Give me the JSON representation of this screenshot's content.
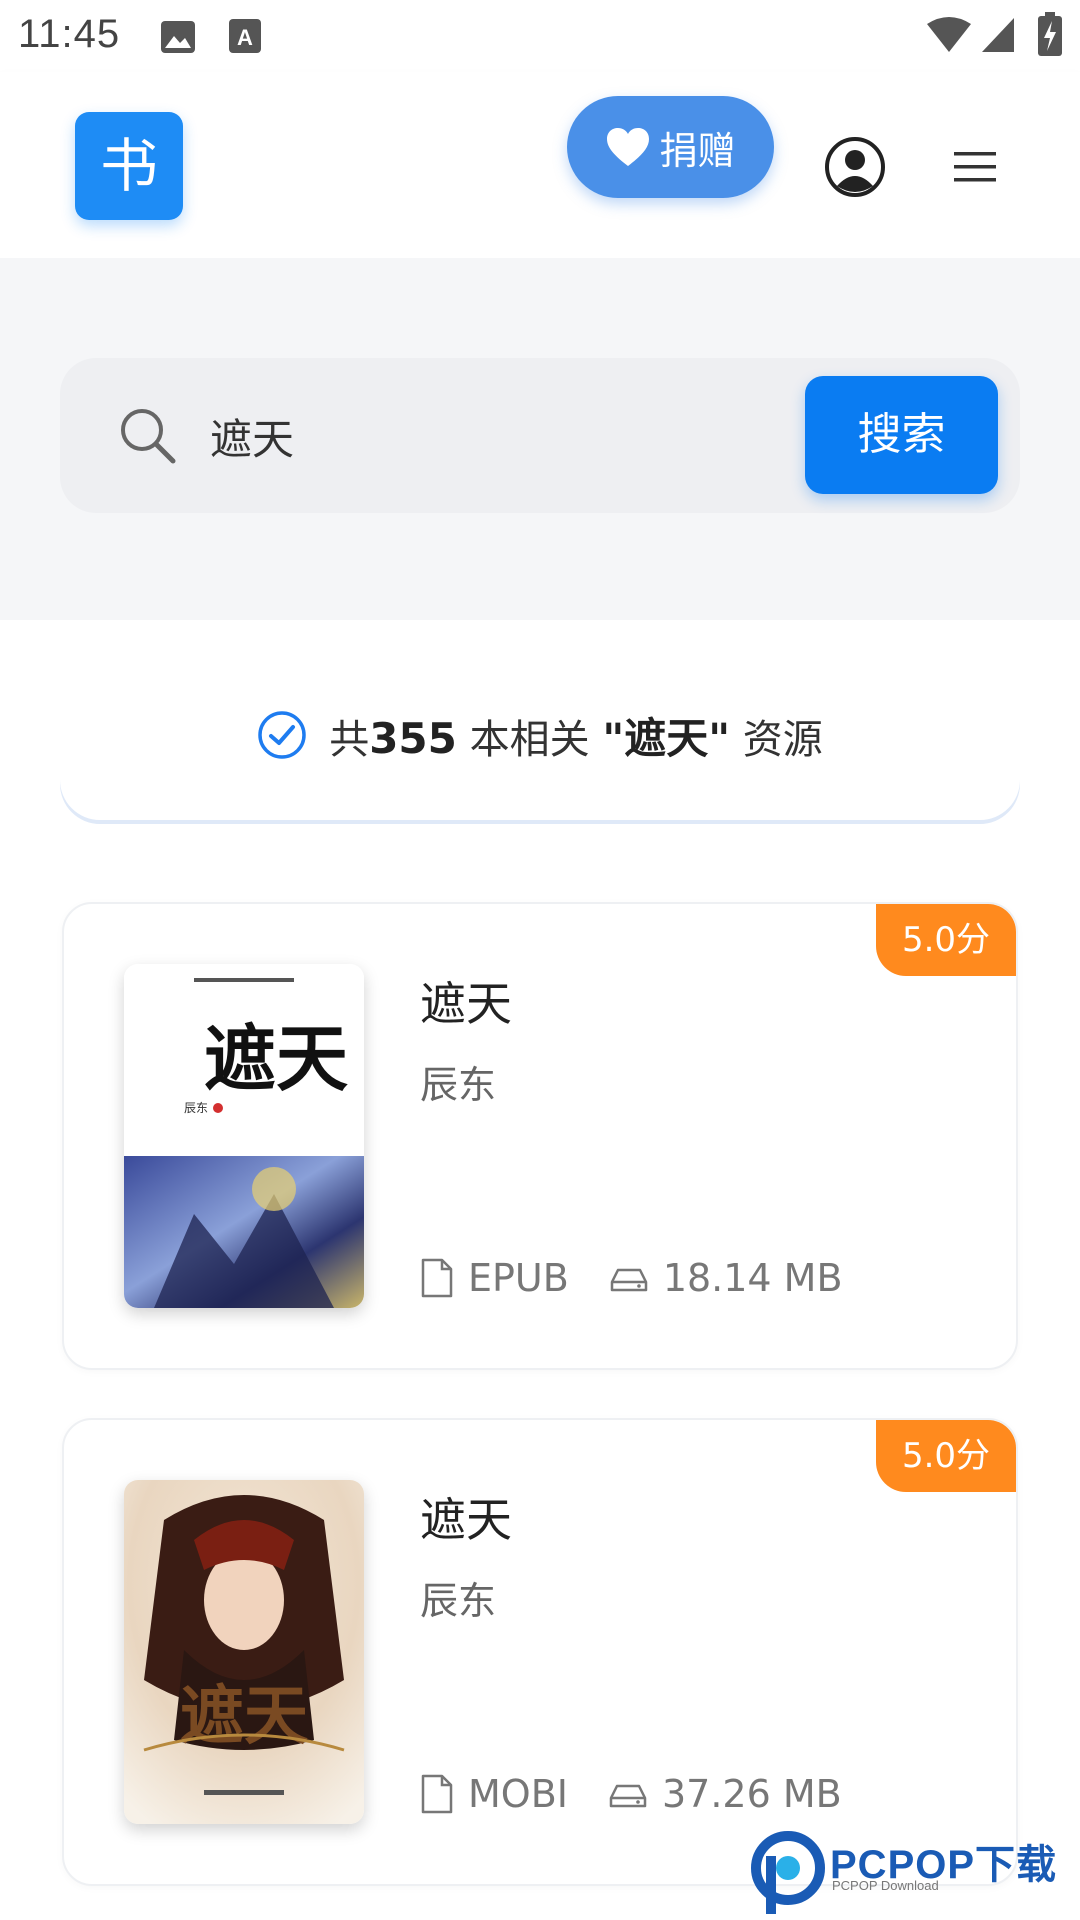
{
  "status_bar": {
    "time": "11:45",
    "icons": [
      "image-icon",
      "font-icon",
      "wifi-icon",
      "signal-icon",
      "battery-icon"
    ]
  },
  "header": {
    "logo_text": "书",
    "donate_label": "捐赠",
    "icons": [
      "heart-icon",
      "user-account-icon",
      "hamburger-menu-icon"
    ]
  },
  "search": {
    "value": "遮天",
    "button_label": "搜索"
  },
  "summary": {
    "prefix": "共",
    "count": "355",
    "middle": " 本相关 ",
    "query_quoted": "\"遮天\"",
    "suffix": " 资源"
  },
  "books": [
    {
      "rating": "5.0分",
      "title": "遮天",
      "author": "辰东",
      "format": "EPUB",
      "size": "18.14 MB",
      "cover_text": "遮天"
    },
    {
      "rating": "5.0分",
      "title": "遮天",
      "author": "辰东",
      "format": "MOBI",
      "size": "37.26 MB",
      "cover_text": "遮天"
    }
  ],
  "watermark": {
    "text": "PCPOP下载",
    "sub": "PCPOP Download"
  },
  "colors": {
    "primary": "#0a7cf2",
    "logo": "#1e8cf5",
    "donate": "#4a90e8",
    "rating": "#ff8a1e"
  }
}
